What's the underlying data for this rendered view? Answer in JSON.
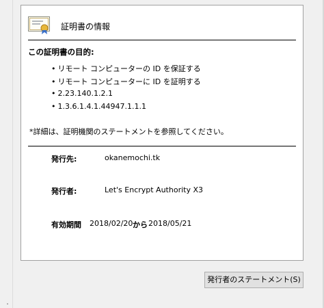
{
  "header": {
    "title": "証明書の情報",
    "icon": "certificate-icon"
  },
  "purposes": {
    "heading": "この証明書の目的:",
    "items": [
      "リモート コンピューターの ID を保証する",
      "リモート コンピューターに ID を証明する",
      "2.23.140.1.2.1",
      "1.3.6.1.4.1.44947.1.1.1"
    ]
  },
  "note": "*詳細は、証明機関のステートメントを参照してください。",
  "details": {
    "issued_to_label": "発行先:",
    "issued_to_value": "okanemochi.tk",
    "issued_by_label": "発行者:",
    "issued_by_value": "Let's Encrypt Authority X3",
    "validity_label": "有効期間",
    "valid_from": "2018/02/20",
    "valid_to_word": "から",
    "valid_to": "2018/05/21"
  },
  "buttons": {
    "issuer_statement": "発行者のステートメント(S)"
  },
  "colors": {
    "panel": "#ffffff",
    "window": "#f0f0f0",
    "button": "#e1e1e1",
    "border": "#a0a0a0"
  }
}
